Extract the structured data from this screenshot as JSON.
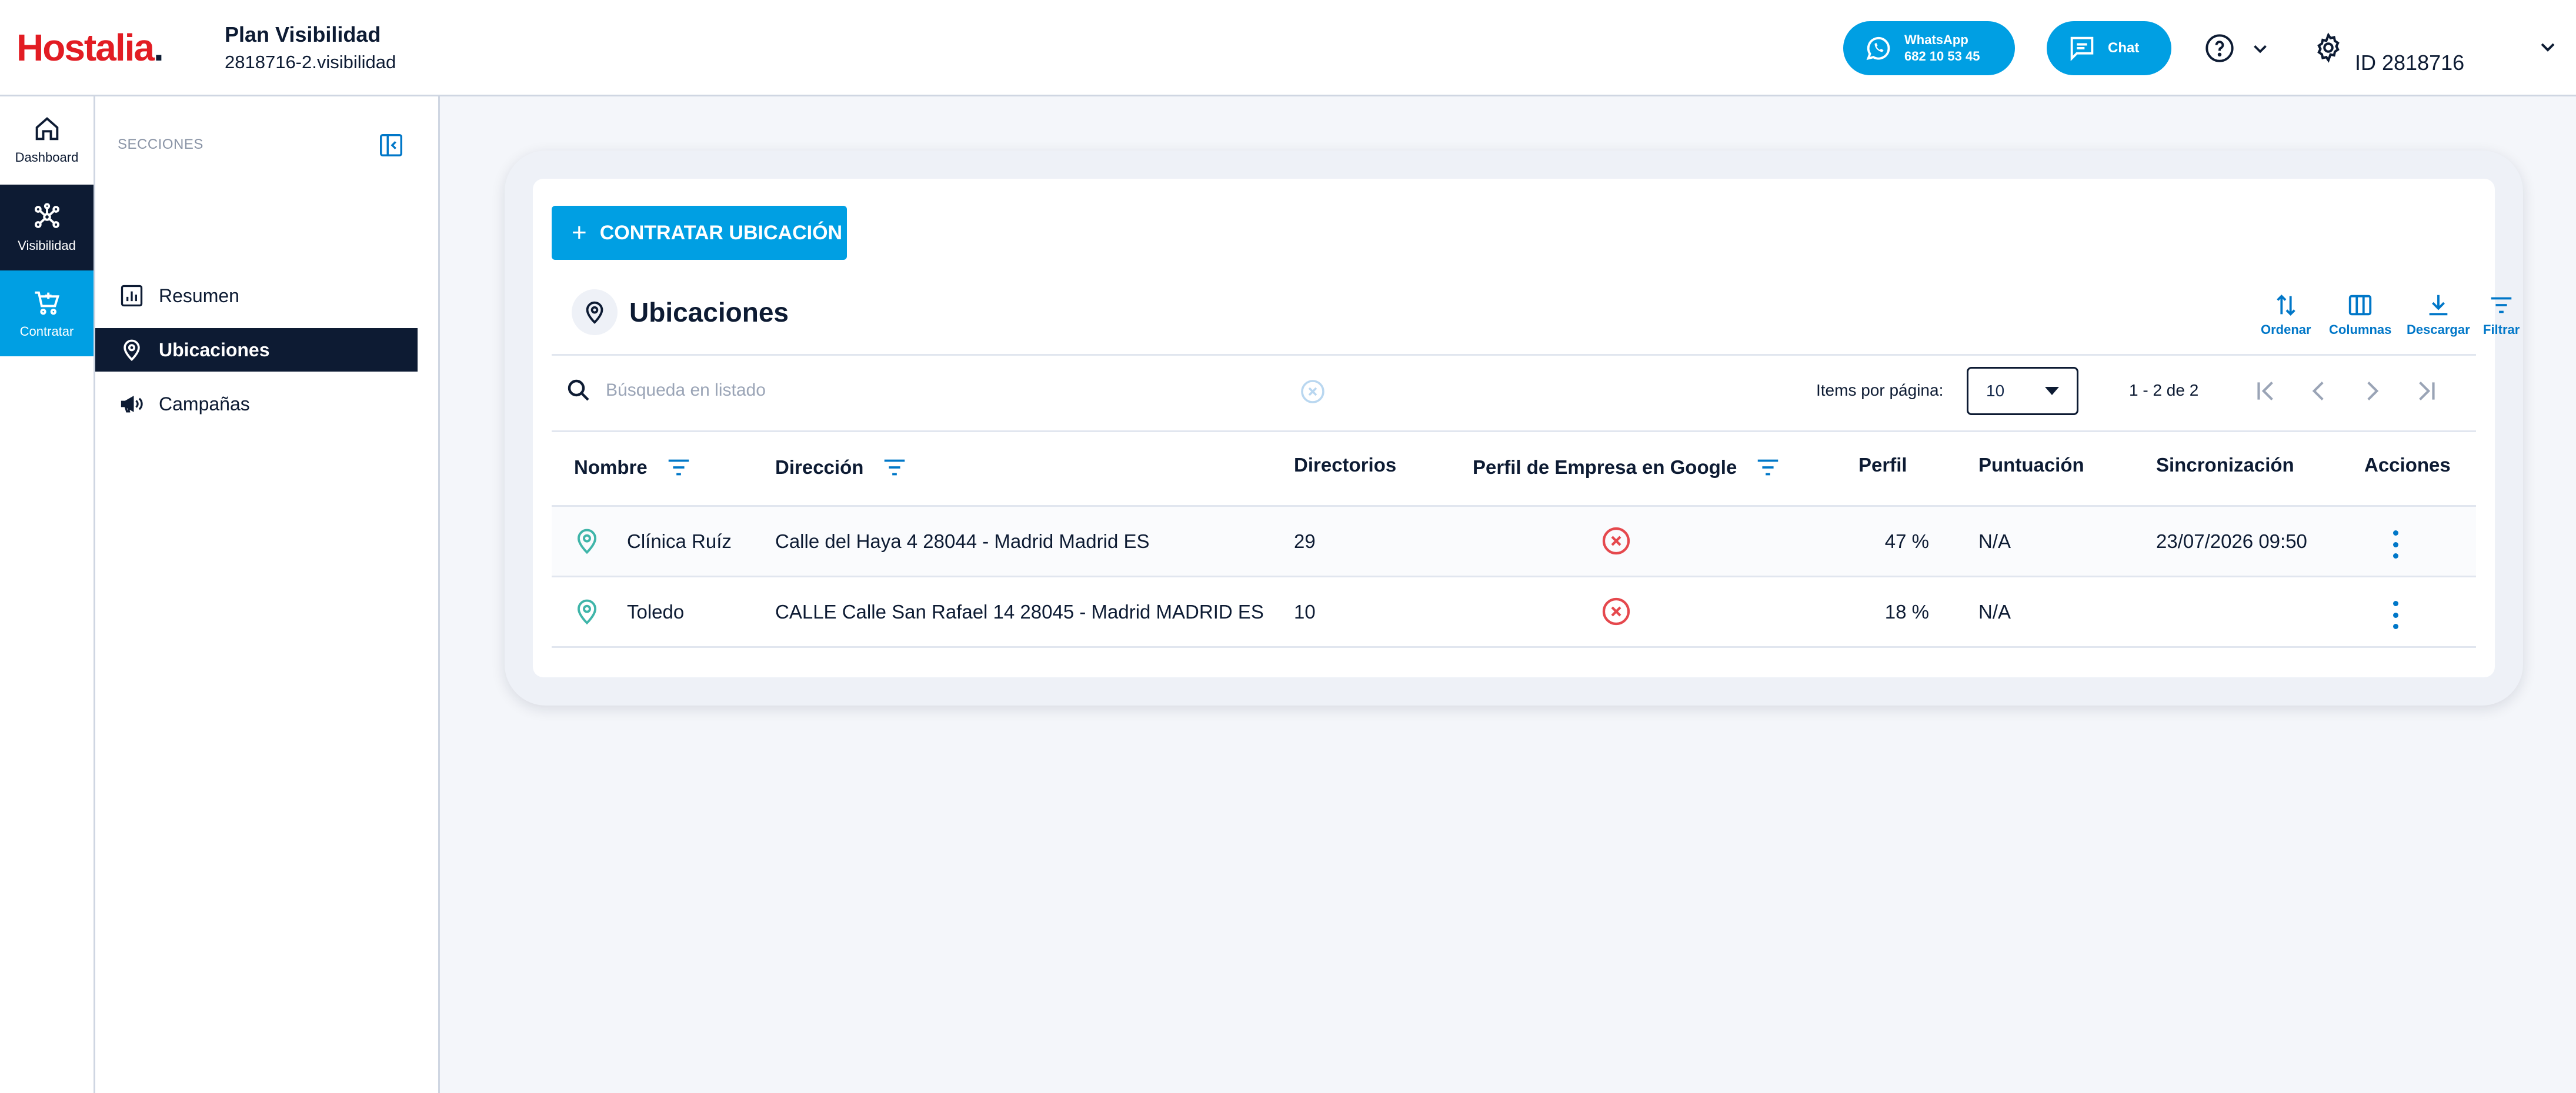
{
  "brand": {
    "name": "Hostalia",
    "dot": "."
  },
  "header": {
    "plan_title": "Plan Visibilidad",
    "plan_subtitle": "2818716-2.visibilidad",
    "whatsapp_label": "WhatsApp",
    "whatsapp_number": "682 10 53 45",
    "chat_label": "Chat",
    "account_id": "ID 2818716"
  },
  "rail": {
    "items": [
      {
        "label": "Dashboard",
        "icon": "home-icon"
      },
      {
        "label": "Visibilidad",
        "icon": "network-icon",
        "active": true
      },
      {
        "label": "Contratar",
        "icon": "cart-icon",
        "highlight": true
      }
    ]
  },
  "sections": {
    "heading": "SECCIONES",
    "items": [
      {
        "label": "Resumen",
        "icon": "chart-icon"
      },
      {
        "label": "Ubicaciones",
        "icon": "location-pin-icon",
        "active": true
      },
      {
        "label": "Campañas",
        "icon": "megaphone-icon"
      }
    ]
  },
  "main": {
    "contract_button": "CONTRATAR UBICACIÓN",
    "list_title": "Ubicaciones",
    "tools": {
      "sort": "Ordenar",
      "columns": "Columnas",
      "download": "Descargar",
      "filter": "Filtrar"
    },
    "search": {
      "placeholder": "Búsqueda en listado",
      "value": ""
    },
    "pagination": {
      "items_per_page_label": "Items por página:",
      "items_per_page": "10",
      "range": "1 - 2 de 2"
    },
    "table": {
      "columns": [
        "Nombre",
        "Dirección",
        "Directorios",
        "Perfil de Empresa en Google",
        "Perfil",
        "Puntuación",
        "Sincronización",
        "Acciones"
      ],
      "rows": [
        {
          "nombre": "Clínica Ruíz",
          "direccion": "Calle del Haya 4 28044 - Madrid Madrid ES",
          "directorios": "29",
          "google_status": "error",
          "perfil": "47 %",
          "puntuacion": "N/A",
          "sincronizacion": "23/07/2026 09:50"
        },
        {
          "nombre": "Toledo",
          "direccion": "CALLE Calle San Rafael 14 28045 - Madrid MADRID ES",
          "directorios": "10",
          "google_status": "error",
          "perfil": "18 %",
          "puntuacion": "N/A",
          "sincronizacion": ""
        }
      ]
    }
  },
  "colors": {
    "brand_red": "#e21c23",
    "navy": "#0d1b33",
    "accent_blue": "#009fe3",
    "link_blue": "#0077c8",
    "pin_teal": "#3fb5a9",
    "error_red": "#e5484d"
  }
}
